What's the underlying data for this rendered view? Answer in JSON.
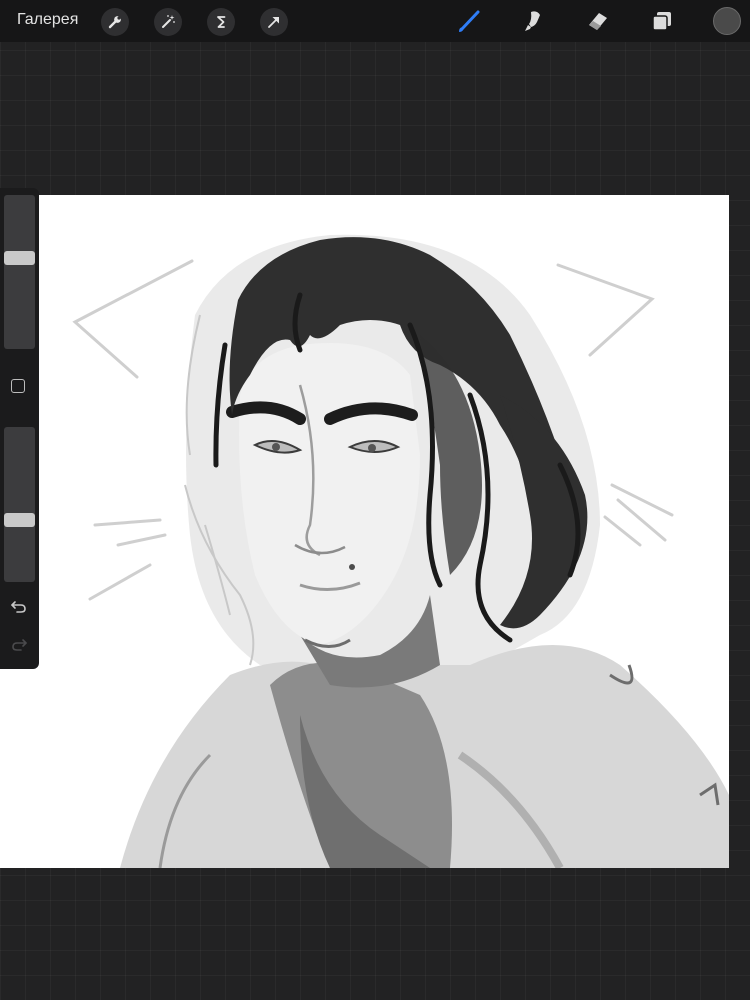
{
  "topbar": {
    "gallery_label": "Галерея",
    "left_tools": [
      "wrench-icon",
      "magic-wand-icon",
      "selection-s-icon",
      "transform-arrow-icon"
    ],
    "right_tools": [
      "brush-icon",
      "smudge-icon",
      "eraser-icon",
      "layers-icon"
    ],
    "active_tool": "brush-icon",
    "accent_color": "#2f7df6",
    "current_color": "#4a4a4a"
  },
  "sidebar": {
    "brush_size_level": 0.6,
    "opacity_level": 0.39
  }
}
